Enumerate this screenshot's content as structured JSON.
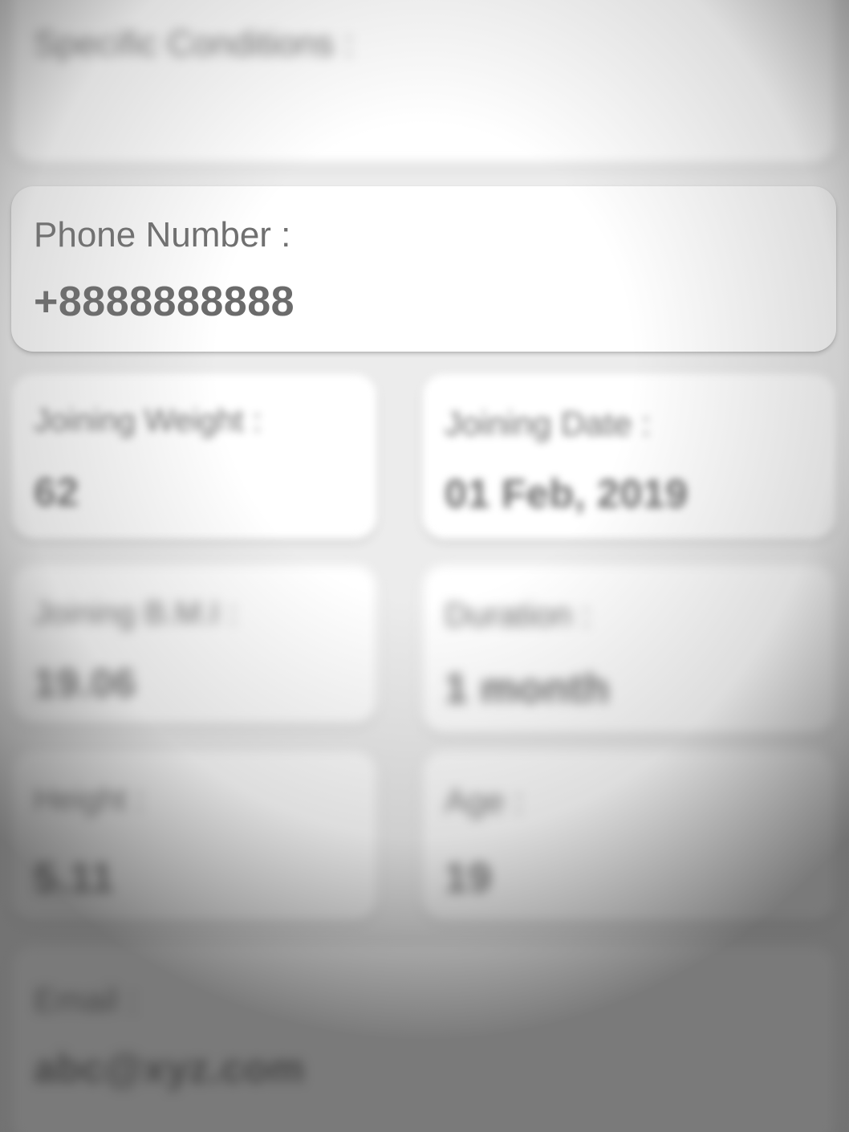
{
  "fields": {
    "specific_conditions": {
      "label": "Specific Conditions :",
      "value": ""
    },
    "phone_number": {
      "label": "Phone Number :",
      "value": "+8888888888"
    },
    "joining_weight": {
      "label": "Joining Weight :",
      "value": "62"
    },
    "joining_date": {
      "label": "Joining Date :",
      "value": "01 Feb, 2019"
    },
    "joining_bmi": {
      "label": "Joining B.M.I :",
      "value": "19.06"
    },
    "duration": {
      "label": "Duration :",
      "value": "1 month"
    },
    "height": {
      "label": "Height :",
      "value": "5.11"
    },
    "age": {
      "label": "Age :",
      "value": "19"
    },
    "email": {
      "label": "Email :",
      "value": "abc@xyz.com"
    }
  }
}
